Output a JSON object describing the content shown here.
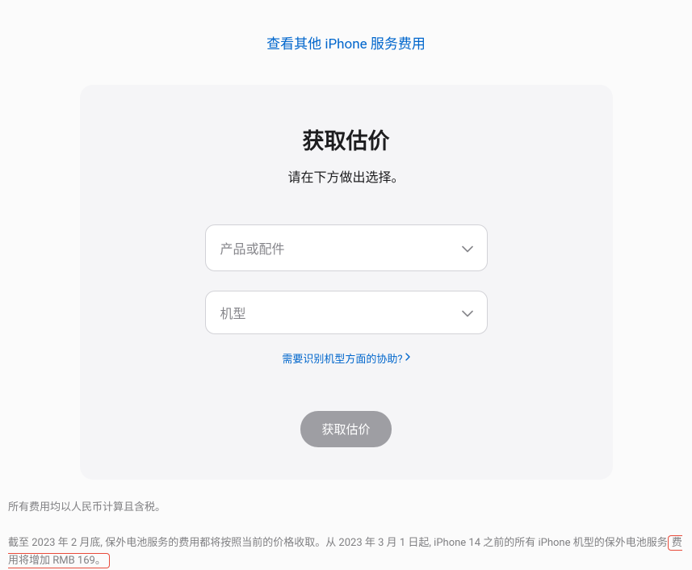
{
  "top_link": "查看其他 iPhone 服务费用",
  "card": {
    "title": "获取估价",
    "subtitle": "请在下方做出选择。",
    "select_product_placeholder": "产品或配件",
    "select_model_placeholder": "机型",
    "help_link": "需要识别机型方面的协助?",
    "submit_label": "获取估价"
  },
  "footer": {
    "line1": "所有费用均以人民币计算且含税。",
    "line2_prefix": "截至 2023 年 2 月底, 保外电池服务的费用都将按照当前的价格收取。从 2023 年 3 月 1 日起, iPhone 14 之前的所有 iPhone 机型的保外电池服务",
    "line2_highlight": "费用将增加 RMB 169。"
  }
}
